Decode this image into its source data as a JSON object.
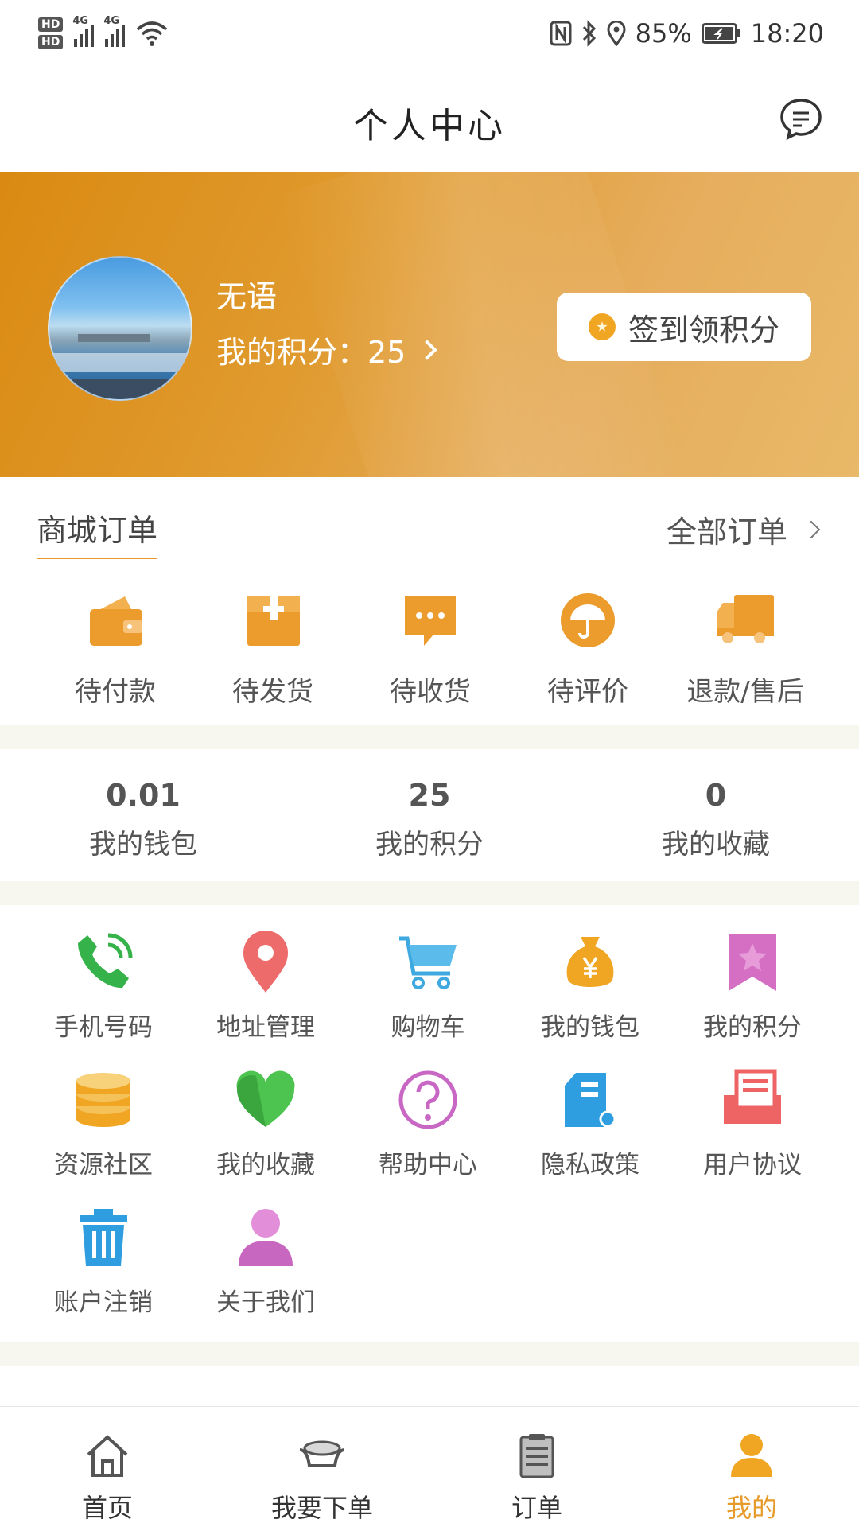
{
  "status_bar": {
    "hd1": "HD",
    "hd2": "HD",
    "net1": "4G",
    "net2": "4G",
    "battery": "85%",
    "time": "18:20"
  },
  "header": {
    "title": "个人中心"
  },
  "profile": {
    "name": "无语",
    "points_label": "我的积分：25",
    "checkin_label": "签到领积分"
  },
  "orders": {
    "title": "商城订单",
    "all_label": "全部订单",
    "items": [
      {
        "label": "待付款",
        "icon": "wallet-icon"
      },
      {
        "label": "待发货",
        "icon": "package-icon"
      },
      {
        "label": "待收货",
        "icon": "chat-bubble-icon"
      },
      {
        "label": "待评价",
        "icon": "umbrella-icon"
      },
      {
        "label": "退款/售后",
        "icon": "truck-icon"
      }
    ]
  },
  "stats": [
    {
      "value": "0.01",
      "label": "我的钱包"
    },
    {
      "value": "25",
      "label": "我的积分"
    },
    {
      "value": "0",
      "label": "我的收藏"
    }
  ],
  "services": [
    {
      "label": "手机号码",
      "icon": "phone-icon"
    },
    {
      "label": "地址管理",
      "icon": "location-pin-icon"
    },
    {
      "label": "购物车",
      "icon": "cart-icon"
    },
    {
      "label": "我的钱包",
      "icon": "money-bag-icon"
    },
    {
      "label": "我的积分",
      "icon": "bookmark-star-icon"
    },
    {
      "label": "资源社区",
      "icon": "coin-stack-icon"
    },
    {
      "label": "我的收藏",
      "icon": "heart-icon"
    },
    {
      "label": "帮助中心",
      "icon": "question-icon"
    },
    {
      "label": "隐私政策",
      "icon": "document-icon"
    },
    {
      "label": "用户协议",
      "icon": "tray-document-icon"
    },
    {
      "label": "账户注销",
      "icon": "trash-icon"
    },
    {
      "label": "关于我们",
      "icon": "user-icon"
    }
  ],
  "bottom_nav": [
    {
      "label": "首页",
      "icon": "home-icon"
    },
    {
      "label": "我要下单",
      "icon": "ingot-icon"
    },
    {
      "label": "订单",
      "icon": "clipboard-icon"
    },
    {
      "label": "我的",
      "icon": "profile-icon",
      "active": true
    }
  ],
  "colors": {
    "accent": "#e69b2b",
    "banner_start": "#da8a12",
    "banner_end": "#e8b968",
    "page_band": "#f7f6ef"
  }
}
